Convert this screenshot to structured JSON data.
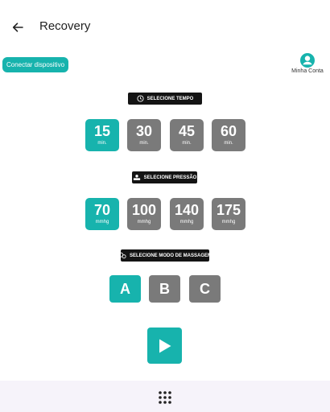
{
  "header": {
    "title": "Recovery"
  },
  "connect_button": "Conectar dispositivo",
  "account": {
    "label": "Minha Conta"
  },
  "time": {
    "label": "SELECIONE TEMPO",
    "options": [
      {
        "value": "15",
        "unit": "min.",
        "selected": true
      },
      {
        "value": "30",
        "unit": "min.",
        "selected": false
      },
      {
        "value": "45",
        "unit": "min.",
        "selected": false
      },
      {
        "value": "60",
        "unit": "min.",
        "selected": false
      }
    ]
  },
  "pressure": {
    "label": "SELECIONE PRESSÃO",
    "options": [
      {
        "value": "70",
        "unit": "mmhg",
        "selected": true
      },
      {
        "value": "100",
        "unit": "mmhg",
        "selected": false
      },
      {
        "value": "140",
        "unit": "mmhg",
        "selected": false
      },
      {
        "value": "175",
        "unit": "mmhg",
        "selected": false
      }
    ]
  },
  "massage": {
    "label": "SELECIONE MODO DE MASSAGEM",
    "modes": [
      {
        "value": "A",
        "selected": true
      },
      {
        "value": "B",
        "selected": false
      },
      {
        "value": "C",
        "selected": false
      }
    ]
  },
  "icons": {
    "back": "arrow-left-icon",
    "account": "user-circle-icon",
    "time": "clock-icon",
    "pressure": "pressure-gauge-icon",
    "massage": "massage-icon",
    "play": "play-icon",
    "apps": "grid-dots-icon"
  },
  "colors": {
    "accent": "#17b3ad",
    "inactive": "#7a7a7a",
    "label_bg": "#141414",
    "nav_bg": "#f6f3fa"
  }
}
